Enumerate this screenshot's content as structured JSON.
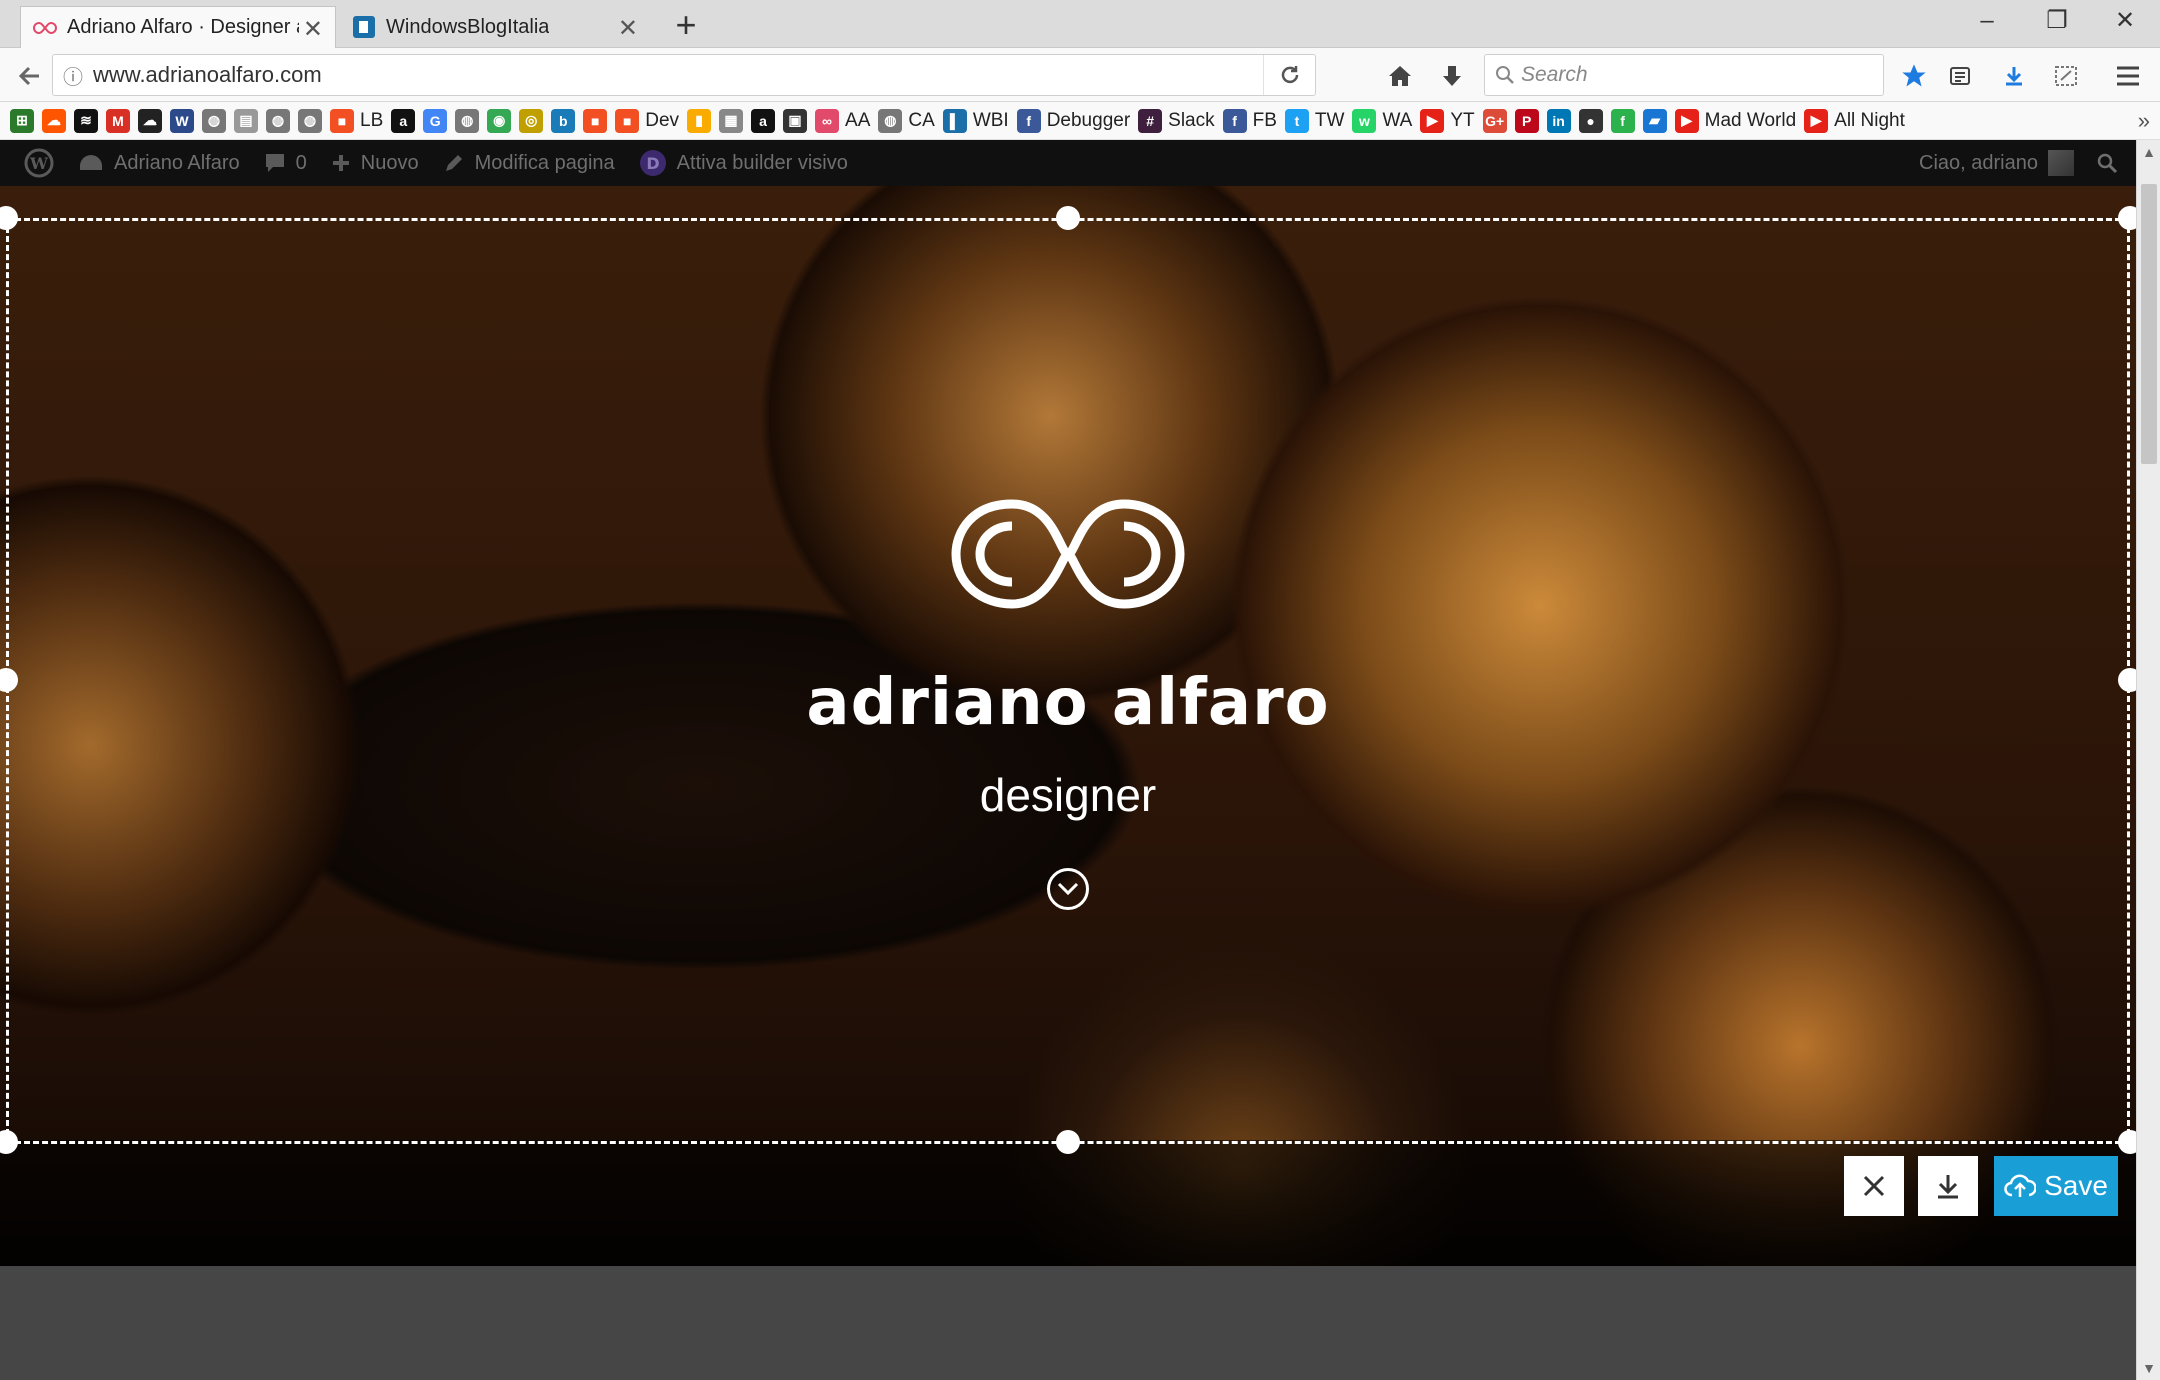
{
  "browser": {
    "tabs": [
      {
        "title": "Adriano Alfaro · Designer a S",
        "active": true
      },
      {
        "title": "WindowsBlogItalia",
        "active": false
      }
    ],
    "url": "www.adrianoalfaro.com",
    "search_placeholder": "Search"
  },
  "bookmarks": [
    {
      "label": "",
      "icon": "grid-app-icon",
      "color": "#2b7a2b"
    },
    {
      "label": "",
      "icon": "soundcloud-icon",
      "color": "#ff5500"
    },
    {
      "label": "",
      "icon": "spotify-icon",
      "color": "#111111"
    },
    {
      "label": "",
      "icon": "gmail-icon",
      "color": "#d93025"
    },
    {
      "label": "",
      "icon": "cloud-icon",
      "color": "#222222"
    },
    {
      "label": "",
      "icon": "wa-icon",
      "color": "#2c4a8a"
    },
    {
      "label": "",
      "icon": "globe-icon",
      "color": "#777777"
    },
    {
      "label": "",
      "icon": "page-icon",
      "color": "#999999"
    },
    {
      "label": "",
      "icon": "globe-icon",
      "color": "#777777"
    },
    {
      "label": "",
      "icon": "globe-icon",
      "color": "#777777"
    },
    {
      "label": "LB",
      "icon": "windows-icon",
      "color": "#f25022"
    },
    {
      "label": "",
      "icon": "amazon-icon",
      "color": "#111111"
    },
    {
      "label": "",
      "icon": "google-icon",
      "color": "#4285f4"
    },
    {
      "label": "",
      "icon": "globe-icon",
      "color": "#777777"
    },
    {
      "label": "",
      "icon": "chrome-icon",
      "color": "#34a853"
    },
    {
      "label": "",
      "icon": "target-icon",
      "color": "#c0a000"
    },
    {
      "label": "",
      "icon": "bing-icon",
      "color": "#1a7bb9"
    },
    {
      "label": "",
      "icon": "windows-icon",
      "color": "#f25022"
    },
    {
      "label": "Dev",
      "icon": "windows-icon",
      "color": "#f25022"
    },
    {
      "label": "",
      "icon": "analytics-icon",
      "color": "#f9ab00"
    },
    {
      "label": "",
      "icon": "calendar-icon",
      "color": "#888888"
    },
    {
      "label": "",
      "icon": "amazon-icon",
      "color": "#111111"
    },
    {
      "label": "",
      "icon": "bag-icon",
      "color": "#333333"
    },
    {
      "label": "AA",
      "icon": "aa-logo-icon",
      "color": "#e24a6b"
    },
    {
      "label": "CA",
      "icon": "globe-icon",
      "color": "#777777"
    },
    {
      "label": "WBI",
      "icon": "wbi-icon",
      "color": "#1b6fa8"
    },
    {
      "label": "Debugger",
      "icon": "facebook-icon",
      "color": "#3b5998"
    },
    {
      "label": "Slack",
      "icon": "hash-icon",
      "color": "#3e1f3e"
    },
    {
      "label": "FB",
      "icon": "facebook-icon",
      "color": "#3b5998"
    },
    {
      "label": "TW",
      "icon": "twitter-icon",
      "color": "#1da1f2"
    },
    {
      "label": "WA",
      "icon": "whatsapp-icon",
      "color": "#25d366"
    },
    {
      "label": "YT",
      "icon": "youtube-icon",
      "color": "#e62117"
    },
    {
      "label": "",
      "icon": "google-plus-icon",
      "color": "#dd4b39"
    },
    {
      "label": "",
      "icon": "pinterest-icon",
      "color": "#bd081c"
    },
    {
      "label": "",
      "icon": "linkedin-icon",
      "color": "#0077b5"
    },
    {
      "label": "",
      "icon": "people-icon",
      "color": "#333333"
    },
    {
      "label": "",
      "icon": "feedly-icon",
      "color": "#2bb24c"
    },
    {
      "label": "",
      "icon": "flag-icon",
      "color": "#1976d2"
    },
    {
      "label": "Mad World",
      "icon": "youtube-icon",
      "color": "#e62117"
    },
    {
      "label": "All Night",
      "icon": "youtube-icon",
      "color": "#e62117"
    }
  ],
  "wpbar": {
    "site_name": "Adriano Alfaro",
    "comments_count": "0",
    "new_label": "Nuovo",
    "edit_label": "Modifica pagina",
    "builder_label": "Attiva builder visivo",
    "greeting": "Ciao, adriano"
  },
  "hero": {
    "brand": "adriano alfaro",
    "tagline": "designer"
  },
  "actions": {
    "save_label": "Save"
  },
  "colors": {
    "accent": "#1a9ed6",
    "wpbar_bg": "#101010"
  }
}
